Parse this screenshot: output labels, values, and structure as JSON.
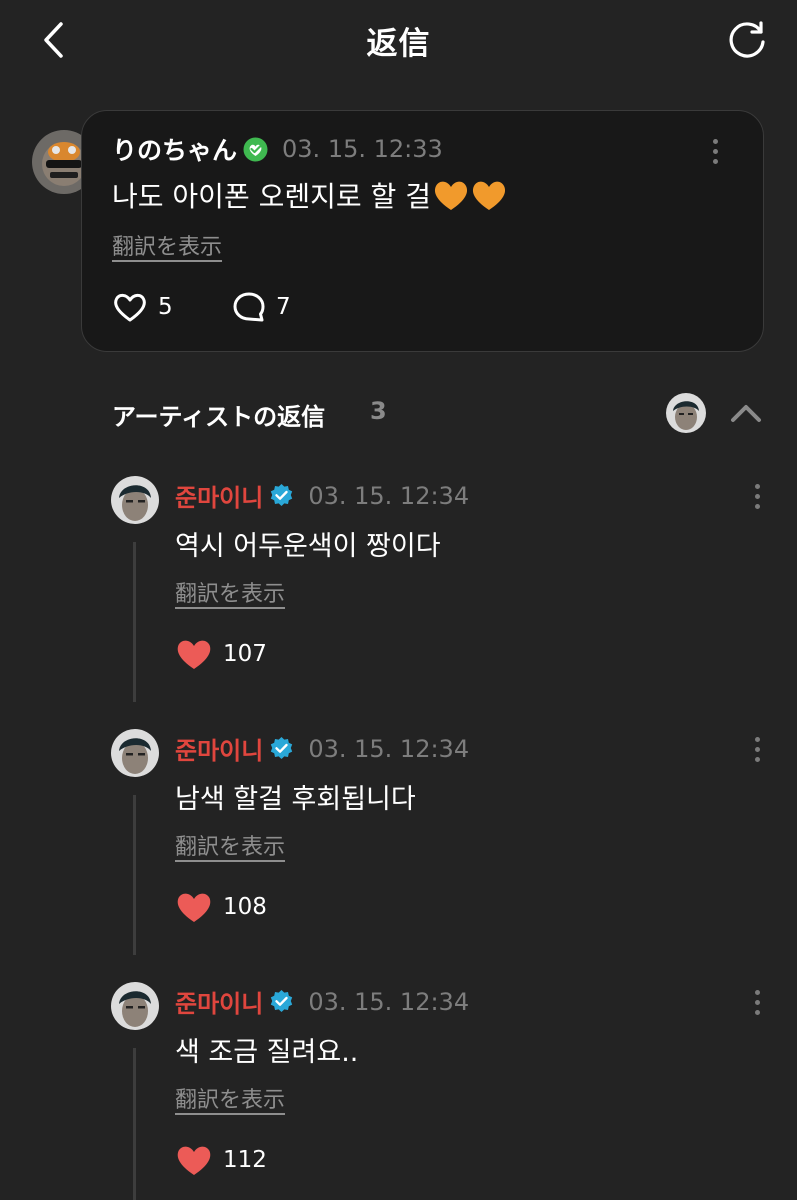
{
  "header": {
    "title": "返信",
    "back_icon": "chevron-left-icon",
    "refresh_icon": "refresh-icon"
  },
  "comment": {
    "username": "りのちゃん",
    "timestamp": "03. 15. 12:33",
    "text": "나도 아이폰 오렌지로 할 걸",
    "emoji": "orange-heart-emoji",
    "translate_label": "翻訳を表示",
    "likes": "5",
    "replies": "7"
  },
  "artist_replies": {
    "title": "アーティストの返信",
    "count": "3",
    "items": [
      {
        "name": "준마이니",
        "timestamp": "03. 15. 12:34",
        "text": "역시 어두운색이 짱이다",
        "translate_label": "翻訳を表示",
        "likes": "107"
      },
      {
        "name": "준마이니",
        "timestamp": "03. 15. 12:34",
        "text": "남색 할걸 후회됩니다",
        "translate_label": "翻訳を表示",
        "likes": "108"
      },
      {
        "name": "준마이니",
        "timestamp": "03. 15. 12:34",
        "text": "색 조금 질려요..",
        "translate_label": "翻訳を表示",
        "likes": "112"
      }
    ]
  },
  "colors": {
    "background": "#232323",
    "card": "#181818",
    "artist_name": "#e0463e",
    "liked_heart": "#ec5b57",
    "verified_user": "#3fb950",
    "verified_artist": "#2aa8d8"
  }
}
